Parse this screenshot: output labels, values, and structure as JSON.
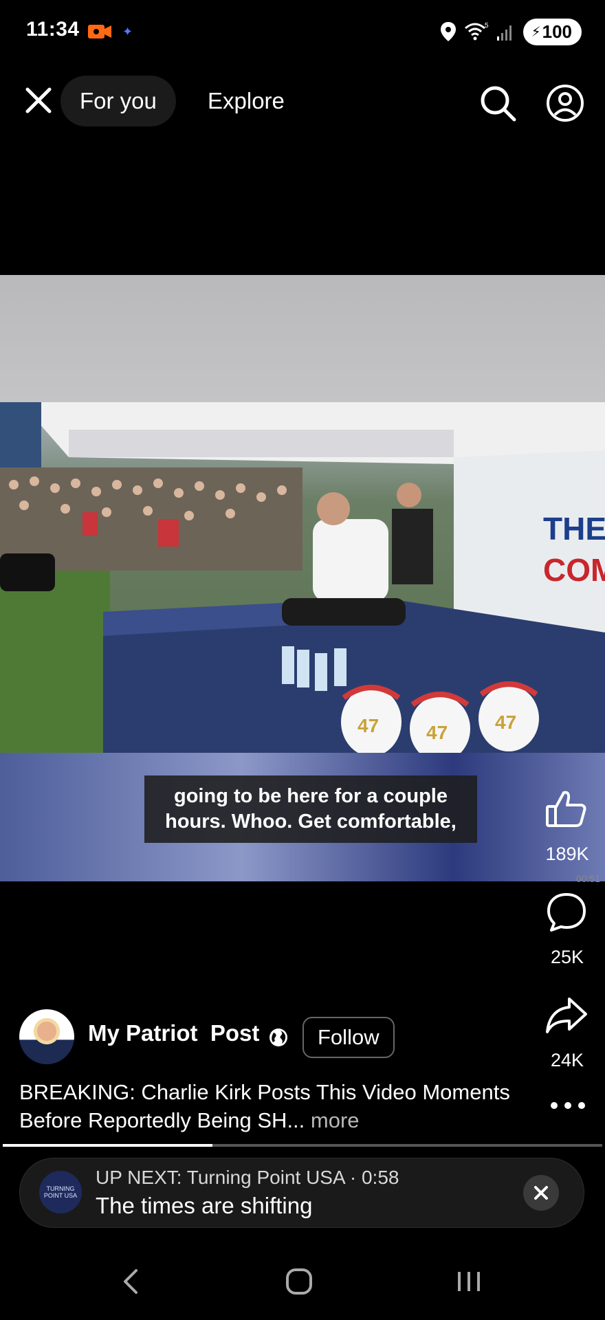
{
  "status_bar": {
    "time": "11:34",
    "battery": "100",
    "accent_record": "#ff6a13"
  },
  "top_nav": {
    "tab_for_you": "For you",
    "tab_explore": "Explore"
  },
  "video": {
    "subtitle_line1": "going to be here for a couple",
    "subtitle_line2": "hours. Whoo. Get comfortable,",
    "timestamp": "00:51",
    "scene_text_main": "THE AMER",
    "scene_text_sub": "COM",
    "hat_number": "47"
  },
  "actions": {
    "like_count": "189K",
    "comment_count": "25K",
    "share_count": "24K"
  },
  "post": {
    "author_name": "My Patriot  Post",
    "follow_label": "Follow",
    "caption_text": "BREAKING: Charlie Kirk Posts This Video Moments Before Reportedly Being SH...",
    "caption_more": "more",
    "progress": 0.35
  },
  "up_next": {
    "label": "UP NEXT: Turning Point USA · 0:58",
    "title": "The times are shifting",
    "logo_text": "TURNING POINT USA"
  },
  "icons": {
    "close": "close-icon",
    "search": "search-icon",
    "profile": "profile-icon",
    "like": "thumbs-up-icon",
    "comment": "comment-icon",
    "share": "share-icon",
    "more": "more-icon",
    "globe": "globe-icon"
  }
}
